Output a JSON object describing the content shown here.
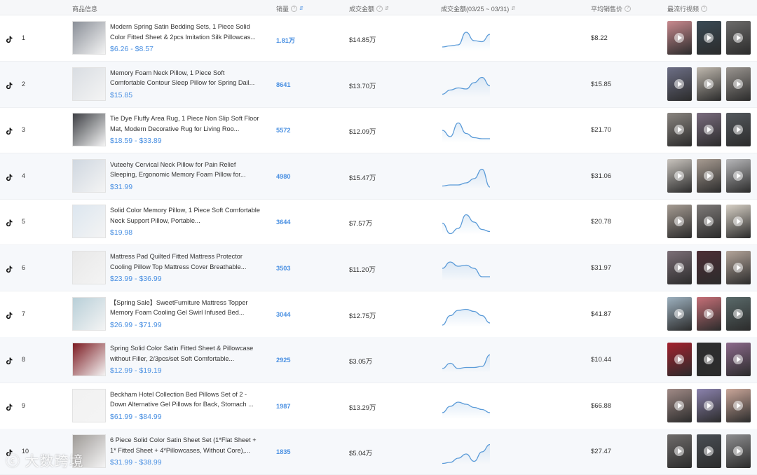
{
  "header": {
    "product": "商品信息",
    "sales": "销量",
    "gmv": "成交金额",
    "trend": "成交金额(03/25 ~ 03/31)",
    "avg_price": "平均销售价",
    "videos": "最流行视频"
  },
  "rows": [
    {
      "rank": "1",
      "title": "Modern Spring Satin Bedding Sets, 1 Piece Solid Color Fitted Sheet & 2pcs Imitation Silk Pillowcas...",
      "price": "$6.26 - $8.57",
      "sales": "1.81万",
      "gmv": "$14.85万",
      "avg": "$8.22",
      "trend": [
        0.2,
        0.25,
        0.3,
        0.9,
        0.5,
        0.45,
        0.8
      ],
      "thumb": "#8a8f98",
      "videos": [
        "#c98a8f",
        "#3a4a55",
        "#6c6b6a"
      ]
    },
    {
      "rank": "2",
      "title": "Memory Foam Neck Pillow, 1 Piece Soft Comfortable Contour Sleep Pillow for Spring Dail...",
      "price": "$15.85",
      "sales": "8641",
      "gmv": "$13.70万",
      "avg": "$15.85",
      "trend": [
        0.15,
        0.35,
        0.45,
        0.4,
        0.7,
        0.95,
        0.55
      ],
      "thumb": "#d9dde2",
      "videos": [
        "#6d6f86",
        "#bfb8ae",
        "#9a9590"
      ]
    },
    {
      "rank": "3",
      "title": "Tie Dye Fluffy Area Rug, 1 Piece Non Slip Soft Floor Mat, Modern Decorative Rug for Living Roo...",
      "price": "$18.59 - $33.89",
      "sales": "5572",
      "gmv": "$12.09万",
      "avg": "$21.70",
      "trend": [
        0.6,
        0.3,
        0.95,
        0.45,
        0.25,
        0.2,
        0.2
      ],
      "thumb": "#3d3f44",
      "videos": [
        "#8a8580",
        "#7a6c7e",
        "#55595e"
      ]
    },
    {
      "rank": "4",
      "title": "Vuteehy Cervical Neck Pillow for Pain Relief Sleeping, Ergonomic Memory Foam Pillow for...",
      "price": "$31.99",
      "sales": "4980",
      "gmv": "$15.47万",
      "avg": "$31.06",
      "trend": [
        0.15,
        0.2,
        0.2,
        0.3,
        0.5,
        0.95,
        0.1
      ],
      "thumb": "#cfd7e0",
      "videos": [
        "#c9c4be",
        "#a89c92",
        "#b7b7b9"
      ]
    },
    {
      "rank": "5",
      "title": "Solid Color Memory Pillow, 1 Piece Soft Comfortable Neck Support Pillow, Portable...",
      "price": "$19.98",
      "sales": "3644",
      "gmv": "$7.57万",
      "avg": "$20.78",
      "trend": [
        0.55,
        0.05,
        0.3,
        0.95,
        0.6,
        0.25,
        0.15
      ],
      "thumb": "#dce6ef",
      "videos": [
        "#a69c93",
        "#7f7b79",
        "#d8d1c6"
      ]
    },
    {
      "rank": "6",
      "title": "Mattress Pad Quilted Fitted Mattress Protector Cooling Pillow Top Mattress Cover Breathable...",
      "price": "$23.99 - $36.99",
      "sales": "3503",
      "gmv": "$11.20万",
      "avg": "$31.97",
      "trend": [
        0.6,
        0.9,
        0.7,
        0.75,
        0.6,
        0.2,
        0.2
      ],
      "thumb": "#e8e8e8",
      "videos": [
        "#7c6f77",
        "#4d2e36",
        "#b4a59a"
      ]
    },
    {
      "rank": "7",
      "title": "【Spring Sale】SweetFurniture Mattress Topper Memory Foam Cooling Gel Swirl Infused Bed...",
      "price": "$26.99 - $71.99",
      "sales": "3044",
      "gmv": "$12.75万",
      "avg": "$41.87",
      "trend": [
        0.1,
        0.55,
        0.8,
        0.85,
        0.75,
        0.55,
        0.2
      ],
      "thumb": "#b8cfd8",
      "videos": [
        "#9db1bf",
        "#c66f77",
        "#5a6a6a"
      ]
    },
    {
      "rank": "8",
      "title": "Spring Solid Color Satin Fitted Sheet & Pillowcase without Filler, 2/3pcs/set Soft Comfortable...",
      "price": "$12.99 - $19.19",
      "sales": "2925",
      "gmv": "$3.05万",
      "avg": "$10.44",
      "trend": [
        0.2,
        0.45,
        0.2,
        0.25,
        0.25,
        0.3,
        0.85
      ],
      "thumb": "#7c1b22",
      "videos": [
        "#a3212e",
        "#2e2e30",
        "#8c6a8c"
      ]
    },
    {
      "rank": "9",
      "title": "Beckham Hotel Collection Bed Pillows Set of 2 - Down Alternative Gel Pillows for Back, Stomach ...",
      "price": "$61.99 - $84.99",
      "sales": "1987",
      "gmv": "$13.29万",
      "avg": "$66.88",
      "trend": [
        0.3,
        0.6,
        0.8,
        0.7,
        0.55,
        0.45,
        0.3
      ],
      "thumb": "#f2f2f2",
      "videos": [
        "#a08a86",
        "#8b82ad",
        "#caa699"
      ]
    },
    {
      "rank": "10",
      "title": "6 Piece Solid Color Satin Sheet Set (1*Flat Sheet + 1* Fitted Sheet + 4*Pillowcases, Without Core),...",
      "price": "$31.99 - $38.99",
      "sales": "1835",
      "gmv": "$5.04万",
      "avg": "$27.47",
      "trend": [
        0.05,
        0.1,
        0.3,
        0.5,
        0.15,
        0.6,
        0.95
      ],
      "thumb": "#9e9a97",
      "videos": [
        "#6f6c6b",
        "#4a4f55",
        "#8e8e90"
      ]
    }
  ],
  "watermark": "大数跨境",
  "colors": {
    "accent": "#4a90e2",
    "spark_line": "#5b9bd8"
  }
}
